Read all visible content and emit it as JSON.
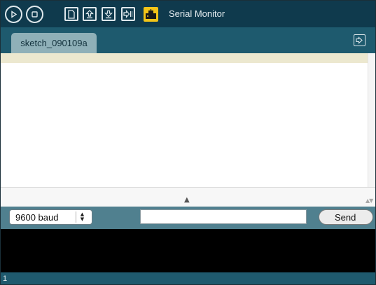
{
  "toolbar": {
    "buttons": [
      {
        "name": "verify",
        "icon": "play-icon"
      },
      {
        "name": "stop",
        "icon": "stop-icon"
      },
      {
        "name": "new",
        "icon": "new-file-icon"
      },
      {
        "name": "open",
        "icon": "open-upload-icon"
      },
      {
        "name": "save",
        "icon": "save-download-icon"
      },
      {
        "name": "upload",
        "icon": "upload-to-board-icon"
      },
      {
        "name": "serial-monitor",
        "icon": "serial-monitor-icon",
        "active": true
      }
    ],
    "title": "Serial Monitor",
    "accent_color": "#f2c418",
    "background_color": "#0f3a4d"
  },
  "tabs": {
    "items": [
      {
        "label": "sketch_090109a",
        "active": true
      }
    ],
    "menu_icon": "tab-menu-arrow-icon"
  },
  "editor": {
    "strip_color": "#ece8cf",
    "splitter_icon": "collapse-arrow-icon"
  },
  "controls": {
    "baud": {
      "value": "9600 baud"
    },
    "send_input": {
      "value": "",
      "placeholder": ""
    },
    "send_label": "Send"
  },
  "status": {
    "line_number": "1"
  }
}
